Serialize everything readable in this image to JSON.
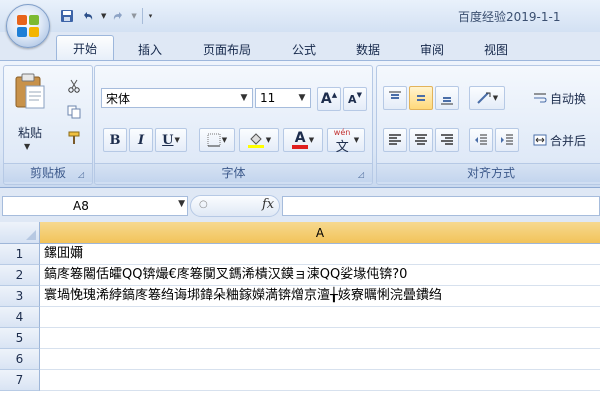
{
  "title_bar": {
    "doc_title": "百度经验2019-1-1",
    "qat": {
      "save": "💾",
      "undo": "↶",
      "redo": "↷",
      "dropdown": "▾"
    }
  },
  "tabs": [
    "开始",
    "插入",
    "页面布局",
    "公式",
    "数据",
    "审阅",
    "视图"
  ],
  "ribbon": {
    "clipboard": {
      "paste_label": "粘贴",
      "group_label": "剪贴板"
    },
    "font": {
      "font_name": "宋体",
      "font_size": "11",
      "grow_label": "A",
      "shrink_label": "A",
      "bold": "B",
      "italic": "I",
      "underline": "U",
      "font_color_letter": "A",
      "phonetic_label": "wén",
      "phonetic_char": "文",
      "group_label": "字体"
    },
    "alignment": {
      "wrap_text_label": "自动换",
      "merge_label": "合并后",
      "group_label": "对齐方式"
    }
  },
  "formula_bar": {
    "name_box": "A8",
    "fx_label": "fx",
    "value": ""
  },
  "sheet": {
    "column_header": "A",
    "rows": [
      {
        "num": "1",
        "value": "鏍囬嬭"
      },
      {
        "num": "2",
        "value": "鎬庝箞闂佸皬QQ锛熶€庝箞闃叉鎷浠樻汉鏌ョ湅QQ娑堟伅锛?0"
      },
      {
        "num": "3",
        "value": "寰堝悗瑰浠綍鎬庝箞绉诲垹鍏朵粬鎵嬫満锛熷京澶╁姟寮曞悧浣曡鐨绉"
      },
      {
        "num": "4",
        "value": ""
      },
      {
        "num": "5",
        "value": ""
      },
      {
        "num": "6",
        "value": ""
      },
      {
        "num": "7",
        "value": ""
      }
    ]
  },
  "colors": {
    "selected_header": "#f2c35a",
    "font_color_bar": "#e02020",
    "fill_color_bar": "#ffff00"
  }
}
